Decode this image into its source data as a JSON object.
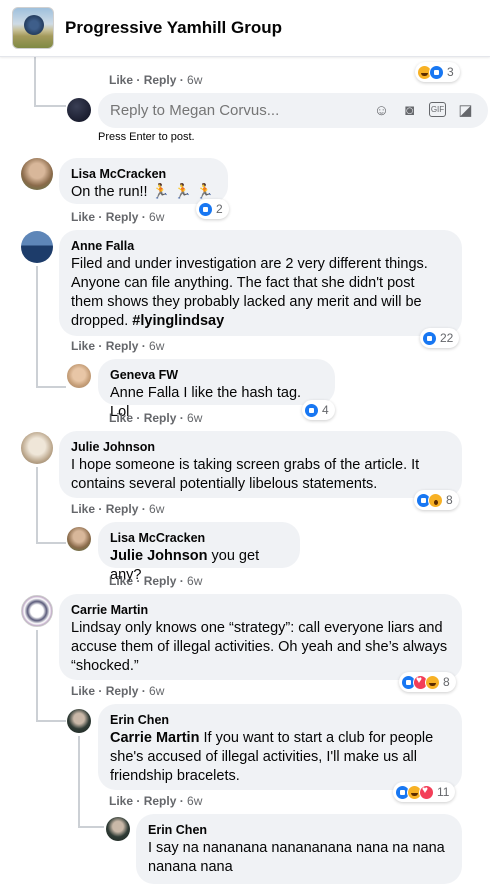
{
  "header": {
    "group_name": "Progressive Yamhill Group"
  },
  "labels": {
    "like": "Like",
    "reply": "Reply",
    "dot": "·"
  },
  "reply_box": {
    "placeholder": "Reply to Megan Corvus...",
    "hint": "Press Enter to post."
  },
  "top_partial": {
    "time": "6w",
    "reaction_count": "3",
    "reactions": [
      "haha",
      "like"
    ]
  },
  "comments": [
    {
      "author": "Lisa McCracken",
      "text": "On the run!! 🏃 🏃 🏃",
      "time": "6w",
      "reaction_count": "2",
      "reactions": [
        "like"
      ],
      "avatar_color": "#8a6a4a"
    },
    {
      "author": "Anne Falla",
      "text_parts": [
        "Filed and under investigation are 2 very different things. Anyone can file anything. The fact that she didn't post them shows they probably lacked any merit and will be dropped. ",
        "#lyinglindsay"
      ],
      "time": "6w",
      "reaction_count": "22",
      "reactions": [
        "like"
      ],
      "avatar_color": "#3b5f8a"
    },
    {
      "author": "Geneva FW",
      "text": "Anne Falla I like the hash tag. Lol",
      "time": "6w",
      "reaction_count": "4",
      "reactions": [
        "like"
      ],
      "avatar_color": "#c7a07a"
    },
    {
      "author": "Julie Johnson",
      "text": "I hope someone is taking screen grabs of the article. It contains several potentially libelous statements.",
      "time": "6w",
      "reaction_count": "8",
      "reactions": [
        "like",
        "wow"
      ],
      "avatar_color": "#b9a489"
    },
    {
      "author": "Lisa McCracken",
      "mention": "Julie Johnson",
      "text": " you get any?",
      "time": "6w",
      "avatar_color": "#8a6a4a"
    },
    {
      "author": "Carrie Martin",
      "text": "Lindsay only knows one “strategy”: call everyone liars and accuse them of illegal activities. Oh yeah and she’s always “shocked.”",
      "time": "6w",
      "reaction_count": "8",
      "reactions": [
        "like",
        "love",
        "haha"
      ],
      "avatar_color": "#5a5a7a"
    },
    {
      "author": "Erin Chen",
      "mention": "Carrie Martin",
      "text": " If you want to start a club for people she's accused of illegal activities, I'll make us all friendship bracelets.",
      "time": "6w",
      "reaction_count": "11",
      "reactions": [
        "like",
        "haha",
        "love"
      ],
      "avatar_color": "#2f3b35"
    },
    {
      "author": "Erin Chen",
      "text": "I say na nananana nanananana nana na nana nanana nana",
      "avatar_color": "#2f3b35"
    }
  ]
}
